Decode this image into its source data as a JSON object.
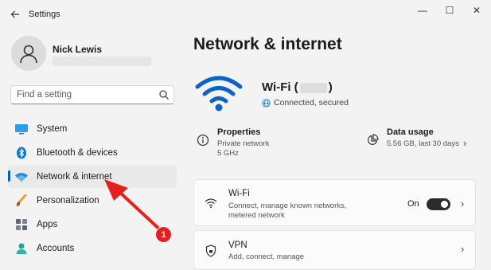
{
  "window": {
    "title": "Settings",
    "controls": {
      "minimize": "—",
      "maximize": "☐",
      "close": "✕"
    }
  },
  "profile": {
    "name": "Nick Lewis"
  },
  "search": {
    "placeholder": "Find a setting"
  },
  "sidebar": {
    "items": [
      {
        "label": "System",
        "icon": "system-monitor-icon"
      },
      {
        "label": "Bluetooth & devices",
        "icon": "bluetooth-icon"
      },
      {
        "label": "Network & internet",
        "icon": "wifi-icon",
        "selected": true
      },
      {
        "label": "Personalization",
        "icon": "paint-brush-icon"
      },
      {
        "label": "Apps",
        "icon": "apps-icon"
      },
      {
        "label": "Accounts",
        "icon": "accounts-icon"
      }
    ]
  },
  "main": {
    "title": "Network & internet",
    "wifi": {
      "title_prefix": "Wi-Fi (",
      "title_suffix": ")",
      "status": "Connected, secured"
    },
    "properties": {
      "title": "Properties",
      "line1": "Private network",
      "line2": "5 GHz"
    },
    "data_usage": {
      "title": "Data usage",
      "line1": "5.56 GB, last 30 days"
    },
    "cards": [
      {
        "title": "Wi-Fi",
        "sub1": "Connect, manage known networks,",
        "sub2": "metered network",
        "toggle_label": "On",
        "toggle_on": true
      },
      {
        "title": "VPN",
        "sub1": "Add, connect, manage"
      }
    ]
  },
  "annotation": {
    "badge": "1",
    "color": "#e5201e"
  },
  "colors": {
    "accent": "#005fb8",
    "background": "#f3f3f3",
    "card": "#fbfbfb"
  }
}
